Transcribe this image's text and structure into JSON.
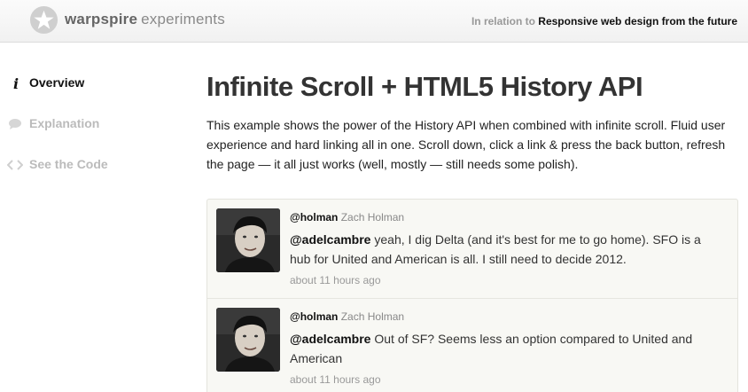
{
  "header": {
    "logo_bold": "warpspire",
    "logo_light": "experiments",
    "relation_prefix": "In relation to",
    "relation_link": "Responsive web design from the future"
  },
  "sidebar": {
    "items": [
      {
        "label": "Overview",
        "icon": "info-icon",
        "active": true
      },
      {
        "label": "Explanation",
        "icon": "speech-bubble-icon",
        "active": false
      },
      {
        "label": "See the Code",
        "icon": "code-brackets-icon",
        "active": false
      }
    ]
  },
  "main": {
    "title": "Infinite Scroll + HTML5 History API",
    "intro": "This example shows the power of the History API when combined with infinite scroll. Fluid user experience and hard linking all in one. Scroll down, click a link & press the back button, refresh the page — it all just works (well, mostly — still needs some polish)."
  },
  "tweets": [
    {
      "handle": "@holman",
      "name": "Zach Holman",
      "mention": "@adelcambre",
      "text": " yeah, I dig Delta (and it's best for me to go home). SFO is a hub for United and American is all. I still need to decide 2012.",
      "time": "about 11 hours ago"
    },
    {
      "handle": "@holman",
      "name": "Zach Holman",
      "mention": "@adelcambre",
      "text": " Out of SF? Seems less an option compared to United and American",
      "time": "about 11 hours ago"
    }
  ],
  "colors": {
    "header_bg": "#f4f4f4",
    "tweet_bg": "#f8f8f4",
    "active_nav": "#111111",
    "inactive_nav": "#bbbbbb"
  }
}
